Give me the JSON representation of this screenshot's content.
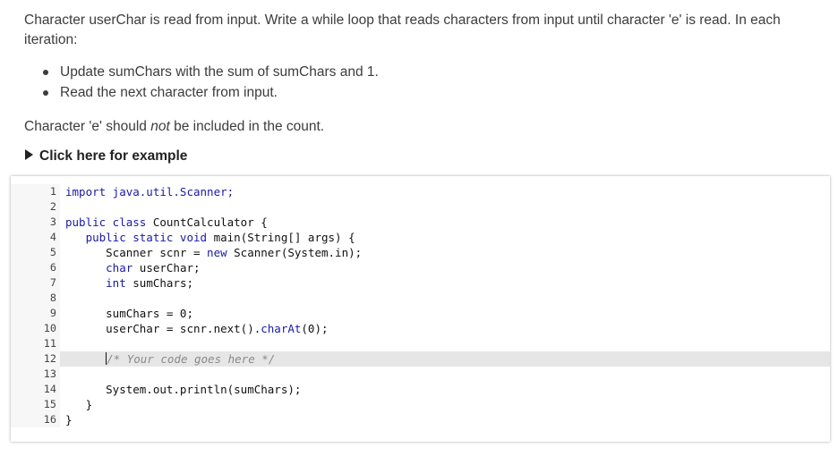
{
  "prompt": {
    "text": "Character userChar is read from input. Write a while loop that reads characters from input until character 'e' is read. In each iteration:",
    "bullets": [
      "Update sumChars with the sum of sumChars and 1.",
      "Read the next character from input."
    ],
    "note_before": "Character 'e' should ",
    "note_em": "not",
    "note_after": " be included in the count.",
    "example_label": "Click here for example"
  },
  "editor": {
    "line_numbers": [
      "1",
      "2",
      "3",
      "4",
      "5",
      "6",
      "7",
      "8",
      "9",
      "10",
      "11",
      "12",
      "13",
      "14",
      "15",
      "16"
    ],
    "active_line": 12,
    "lines": [
      [
        {
          "t": "import java.util.Scanner;",
          "c": "kw"
        }
      ],
      [],
      [
        {
          "t": "public class ",
          "c": "kw"
        },
        {
          "t": "CountCalculator {",
          "c": ""
        }
      ],
      [
        {
          "t": "   public static void ",
          "c": "kw"
        },
        {
          "t": "main(String[] args) {",
          "c": ""
        }
      ],
      [
        {
          "t": "      Scanner scnr = ",
          "c": ""
        },
        {
          "t": "new ",
          "c": "kw"
        },
        {
          "t": "Scanner(System.in);",
          "c": ""
        }
      ],
      [
        {
          "t": "      char ",
          "c": "kw"
        },
        {
          "t": "userChar;",
          "c": ""
        }
      ],
      [
        {
          "t": "      int ",
          "c": "kw"
        },
        {
          "t": "sumChars;",
          "c": ""
        }
      ],
      [],
      [
        {
          "t": "      sumChars = 0;",
          "c": ""
        }
      ],
      [
        {
          "t": "      userChar = scnr.next().",
          "c": ""
        },
        {
          "t": "charAt",
          "c": "kw"
        },
        {
          "t": "(0);",
          "c": ""
        }
      ],
      [],
      [
        {
          "t": "      ",
          "c": ""
        },
        {
          "t": "|cursor|",
          "c": "cursor"
        },
        {
          "t": "/* Your code goes here */",
          "c": "cm"
        }
      ],
      [],
      [
        {
          "t": "      System.out.println(sumChars);",
          "c": ""
        }
      ],
      [
        {
          "t": "   }",
          "c": ""
        }
      ],
      [
        {
          "t": "}",
          "c": ""
        }
      ]
    ]
  }
}
